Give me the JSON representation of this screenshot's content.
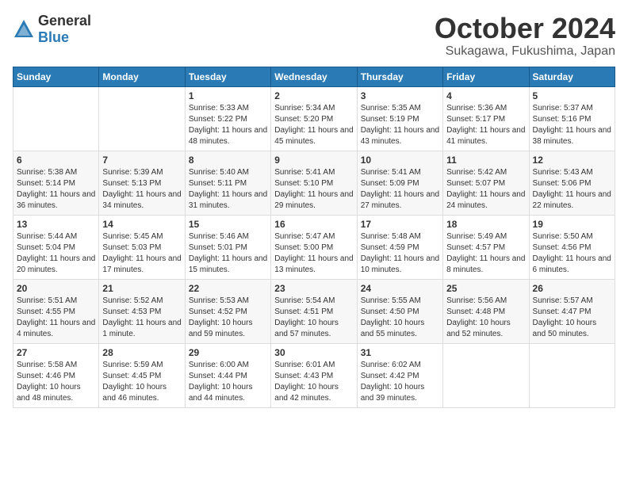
{
  "logo": {
    "general": "General",
    "blue": "Blue"
  },
  "header": {
    "month": "October 2024",
    "location": "Sukagawa, Fukushima, Japan"
  },
  "weekdays": [
    "Sunday",
    "Monday",
    "Tuesday",
    "Wednesday",
    "Thursday",
    "Friday",
    "Saturday"
  ],
  "weeks": [
    [
      {
        "day": "",
        "info": ""
      },
      {
        "day": "",
        "info": ""
      },
      {
        "day": "1",
        "info": "Sunrise: 5:33 AM\nSunset: 5:22 PM\nDaylight: 11 hours and 48 minutes."
      },
      {
        "day": "2",
        "info": "Sunrise: 5:34 AM\nSunset: 5:20 PM\nDaylight: 11 hours and 45 minutes."
      },
      {
        "day": "3",
        "info": "Sunrise: 5:35 AM\nSunset: 5:19 PM\nDaylight: 11 hours and 43 minutes."
      },
      {
        "day": "4",
        "info": "Sunrise: 5:36 AM\nSunset: 5:17 PM\nDaylight: 11 hours and 41 minutes."
      },
      {
        "day": "5",
        "info": "Sunrise: 5:37 AM\nSunset: 5:16 PM\nDaylight: 11 hours and 38 minutes."
      }
    ],
    [
      {
        "day": "6",
        "info": "Sunrise: 5:38 AM\nSunset: 5:14 PM\nDaylight: 11 hours and 36 minutes."
      },
      {
        "day": "7",
        "info": "Sunrise: 5:39 AM\nSunset: 5:13 PM\nDaylight: 11 hours and 34 minutes."
      },
      {
        "day": "8",
        "info": "Sunrise: 5:40 AM\nSunset: 5:11 PM\nDaylight: 11 hours and 31 minutes."
      },
      {
        "day": "9",
        "info": "Sunrise: 5:41 AM\nSunset: 5:10 PM\nDaylight: 11 hours and 29 minutes."
      },
      {
        "day": "10",
        "info": "Sunrise: 5:41 AM\nSunset: 5:09 PM\nDaylight: 11 hours and 27 minutes."
      },
      {
        "day": "11",
        "info": "Sunrise: 5:42 AM\nSunset: 5:07 PM\nDaylight: 11 hours and 24 minutes."
      },
      {
        "day": "12",
        "info": "Sunrise: 5:43 AM\nSunset: 5:06 PM\nDaylight: 11 hours and 22 minutes."
      }
    ],
    [
      {
        "day": "13",
        "info": "Sunrise: 5:44 AM\nSunset: 5:04 PM\nDaylight: 11 hours and 20 minutes."
      },
      {
        "day": "14",
        "info": "Sunrise: 5:45 AM\nSunset: 5:03 PM\nDaylight: 11 hours and 17 minutes."
      },
      {
        "day": "15",
        "info": "Sunrise: 5:46 AM\nSunset: 5:01 PM\nDaylight: 11 hours and 15 minutes."
      },
      {
        "day": "16",
        "info": "Sunrise: 5:47 AM\nSunset: 5:00 PM\nDaylight: 11 hours and 13 minutes."
      },
      {
        "day": "17",
        "info": "Sunrise: 5:48 AM\nSunset: 4:59 PM\nDaylight: 11 hours and 10 minutes."
      },
      {
        "day": "18",
        "info": "Sunrise: 5:49 AM\nSunset: 4:57 PM\nDaylight: 11 hours and 8 minutes."
      },
      {
        "day": "19",
        "info": "Sunrise: 5:50 AM\nSunset: 4:56 PM\nDaylight: 11 hours and 6 minutes."
      }
    ],
    [
      {
        "day": "20",
        "info": "Sunrise: 5:51 AM\nSunset: 4:55 PM\nDaylight: 11 hours and 4 minutes."
      },
      {
        "day": "21",
        "info": "Sunrise: 5:52 AM\nSunset: 4:53 PM\nDaylight: 11 hours and 1 minute."
      },
      {
        "day": "22",
        "info": "Sunrise: 5:53 AM\nSunset: 4:52 PM\nDaylight: 10 hours and 59 minutes."
      },
      {
        "day": "23",
        "info": "Sunrise: 5:54 AM\nSunset: 4:51 PM\nDaylight: 10 hours and 57 minutes."
      },
      {
        "day": "24",
        "info": "Sunrise: 5:55 AM\nSunset: 4:50 PM\nDaylight: 10 hours and 55 minutes."
      },
      {
        "day": "25",
        "info": "Sunrise: 5:56 AM\nSunset: 4:48 PM\nDaylight: 10 hours and 52 minutes."
      },
      {
        "day": "26",
        "info": "Sunrise: 5:57 AM\nSunset: 4:47 PM\nDaylight: 10 hours and 50 minutes."
      }
    ],
    [
      {
        "day": "27",
        "info": "Sunrise: 5:58 AM\nSunset: 4:46 PM\nDaylight: 10 hours and 48 minutes."
      },
      {
        "day": "28",
        "info": "Sunrise: 5:59 AM\nSunset: 4:45 PM\nDaylight: 10 hours and 46 minutes."
      },
      {
        "day": "29",
        "info": "Sunrise: 6:00 AM\nSunset: 4:44 PM\nDaylight: 10 hours and 44 minutes."
      },
      {
        "day": "30",
        "info": "Sunrise: 6:01 AM\nSunset: 4:43 PM\nDaylight: 10 hours and 42 minutes."
      },
      {
        "day": "31",
        "info": "Sunrise: 6:02 AM\nSunset: 4:42 PM\nDaylight: 10 hours and 39 minutes."
      },
      {
        "day": "",
        "info": ""
      },
      {
        "day": "",
        "info": ""
      }
    ]
  ]
}
